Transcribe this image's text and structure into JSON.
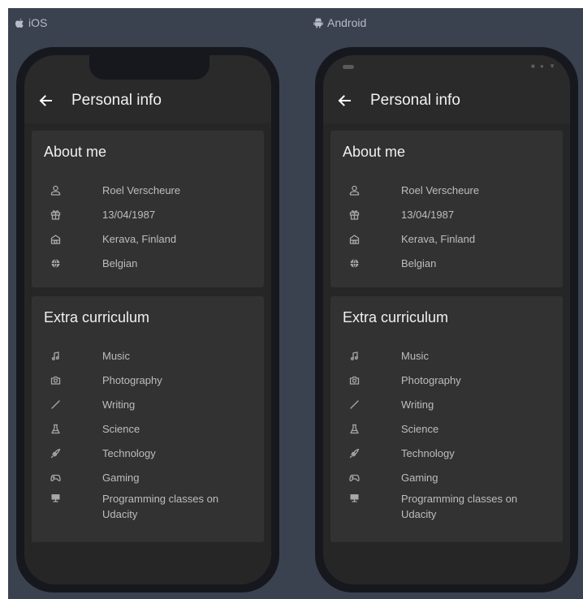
{
  "platforms": {
    "ios": {
      "label": "iOS"
    },
    "android": {
      "label": "Android"
    }
  },
  "appbar": {
    "title": "Personal info"
  },
  "about": {
    "title": "About me",
    "items": [
      {
        "icon": "person-icon",
        "label": "Roel Verscheure"
      },
      {
        "icon": "gift-icon",
        "label": "13/04/1987"
      },
      {
        "icon": "house-icon",
        "label": "Kerava, Finland"
      },
      {
        "icon": "globe-icon",
        "label": "Belgian"
      }
    ]
  },
  "extra": {
    "title": "Extra curriculum",
    "items": [
      {
        "icon": "music-note-icon",
        "label": "Music"
      },
      {
        "icon": "camera-icon",
        "label": "Photography"
      },
      {
        "icon": "pen-icon",
        "label": "Writing"
      },
      {
        "icon": "flask-icon",
        "label": "Science"
      },
      {
        "icon": "rocket-icon",
        "label": "Technology"
      },
      {
        "icon": "gamepad-icon",
        "label": "Gaming"
      },
      {
        "icon": "monitor-icon",
        "label": "Programming classes on Udacity"
      }
    ]
  },
  "colors": {
    "stage": "#3a4250",
    "phone_frame": "#16181d",
    "screen": "#2a2a2a",
    "card": "#323232"
  }
}
